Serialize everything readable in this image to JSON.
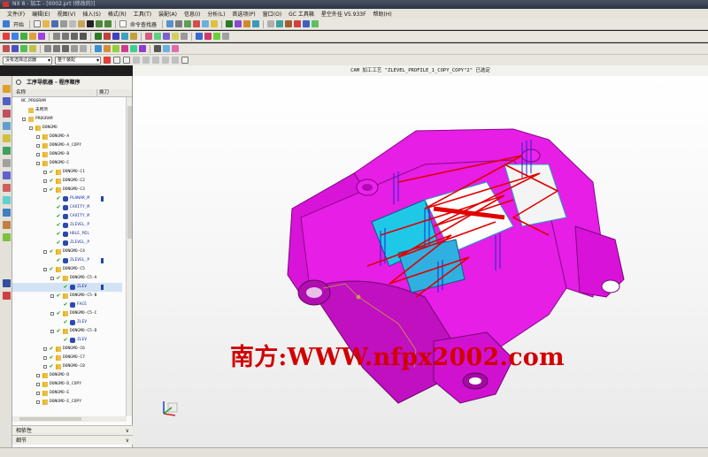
{
  "window": {
    "title_text": "NX 8 - 加工 - [0002.prt (修改的)]"
  },
  "menu": [
    "文件(F)",
    "编辑(E)",
    "视图(V)",
    "插入(S)",
    "格式(R)",
    "工具(T)",
    "装配(A)",
    "信息(I)",
    "分析(L)",
    "首选项(P)",
    "窗口(O)",
    "GC 工具箱",
    "星空外挂 V5.933F",
    "帮助(H)"
  ],
  "toolbar": {
    "start_label": "开始",
    "command_finder": "命令查找器"
  },
  "filterbar": {
    "filter_combo": "没有选择过滤器",
    "scope_combo": "整个装配"
  },
  "status": {
    "message": "CAM 加工工艺 \"ZLEVEL_PROFILE_1_COPY_COPY\"2\" 已选定"
  },
  "navigator": {
    "title": "工序导航器 - 程序顺序",
    "col_name": "名称",
    "col_tool": "换刀",
    "rows": [
      {
        "indent": 0,
        "text": "NC_PROGRAM",
        "type": "root"
      },
      {
        "indent": 1,
        "text": "未用项",
        "type": "folder"
      },
      {
        "indent": 1,
        "text": "PROGRAM",
        "type": "folder",
        "exp": "-"
      },
      {
        "indent": 2,
        "text": "DONGMO",
        "type": "group",
        "exp": "-"
      },
      {
        "indent": 3,
        "text": "DONGMO-A",
        "type": "group",
        "exp": "+"
      },
      {
        "indent": 3,
        "text": "DONGMO-A_COPY",
        "type": "group",
        "exp": "+"
      },
      {
        "indent": 3,
        "text": "DONGMO-B",
        "type": "group",
        "exp": "+"
      },
      {
        "indent": 3,
        "text": "DONGMO-C",
        "type": "group",
        "exp": "-"
      },
      {
        "indent": 4,
        "text": "DONGMO-C1",
        "type": "group-ok",
        "exp": "+"
      },
      {
        "indent": 4,
        "text": "DONGMO-C2",
        "type": "group-ok",
        "exp": "+"
      },
      {
        "indent": 4,
        "text": "DONGMO-C3",
        "type": "group-ok",
        "exp": "-"
      },
      {
        "indent": 5,
        "text": "PLANAR_M",
        "type": "op",
        "tool": true
      },
      {
        "indent": 5,
        "text": "CAVITY_M",
        "type": "op"
      },
      {
        "indent": 5,
        "text": "CAVITY_M",
        "type": "op"
      },
      {
        "indent": 5,
        "text": "ZLEVEL_P",
        "type": "op"
      },
      {
        "indent": 5,
        "text": "HOLE_MIL",
        "type": "op"
      },
      {
        "indent": 5,
        "text": "ZLEVEL_P",
        "type": "op"
      },
      {
        "indent": 4,
        "text": "DONGMO-C4",
        "type": "group-ok",
        "exp": "-"
      },
      {
        "indent": 5,
        "text": "ZLEVEL_P",
        "type": "op",
        "tool": true
      },
      {
        "indent": 4,
        "text": "DONGMO-C5",
        "type": "group-ok",
        "exp": "-"
      },
      {
        "indent": 5,
        "text": "DONGMO-C5-A",
        "type": "group-ok",
        "exp": "-"
      },
      {
        "indent": 6,
        "text": "ZLEV",
        "type": "op-sel",
        "tool": true
      },
      {
        "indent": 5,
        "text": "DONGMO-C5-B",
        "type": "group-ok",
        "exp": "-"
      },
      {
        "indent": 6,
        "text": "FACE",
        "type": "op"
      },
      {
        "indent": 5,
        "text": "DONGMO-C5-C",
        "type": "group-ok",
        "exp": "-"
      },
      {
        "indent": 6,
        "text": "ZLEV",
        "type": "op"
      },
      {
        "indent": 5,
        "text": "DONGMO-C5-D",
        "type": "group-ok",
        "exp": "-"
      },
      {
        "indent": 6,
        "text": "ZLEV",
        "type": "op"
      },
      {
        "indent": 4,
        "text": "DONGMO-C6",
        "type": "group-ok",
        "exp": "+"
      },
      {
        "indent": 4,
        "text": "DONGMO-C7",
        "type": "group-ok",
        "exp": "+"
      },
      {
        "indent": 4,
        "text": "DONGMO-C8",
        "type": "group-ok",
        "exp": "+"
      },
      {
        "indent": 3,
        "text": "DONGMO-D",
        "type": "group",
        "exp": "+"
      },
      {
        "indent": 3,
        "text": "DONGMO-D_COPY",
        "type": "group",
        "exp": "+"
      },
      {
        "indent": 3,
        "text": "DONGMO-E",
        "type": "group",
        "exp": "+"
      },
      {
        "indent": 3,
        "text": "DONGMO-E_COPY",
        "type": "group",
        "exp": "+"
      }
    ],
    "dependencies_label": "相依性",
    "details_label": "细节"
  },
  "watermark": {
    "text": "南方:WWW.nfpx2002.com"
  },
  "colors": {
    "part_magenta": "#e61ee6",
    "toolpath_red": "#e00000",
    "watermark_red": "#d10000",
    "selection_blue": "#d2e3f5"
  }
}
